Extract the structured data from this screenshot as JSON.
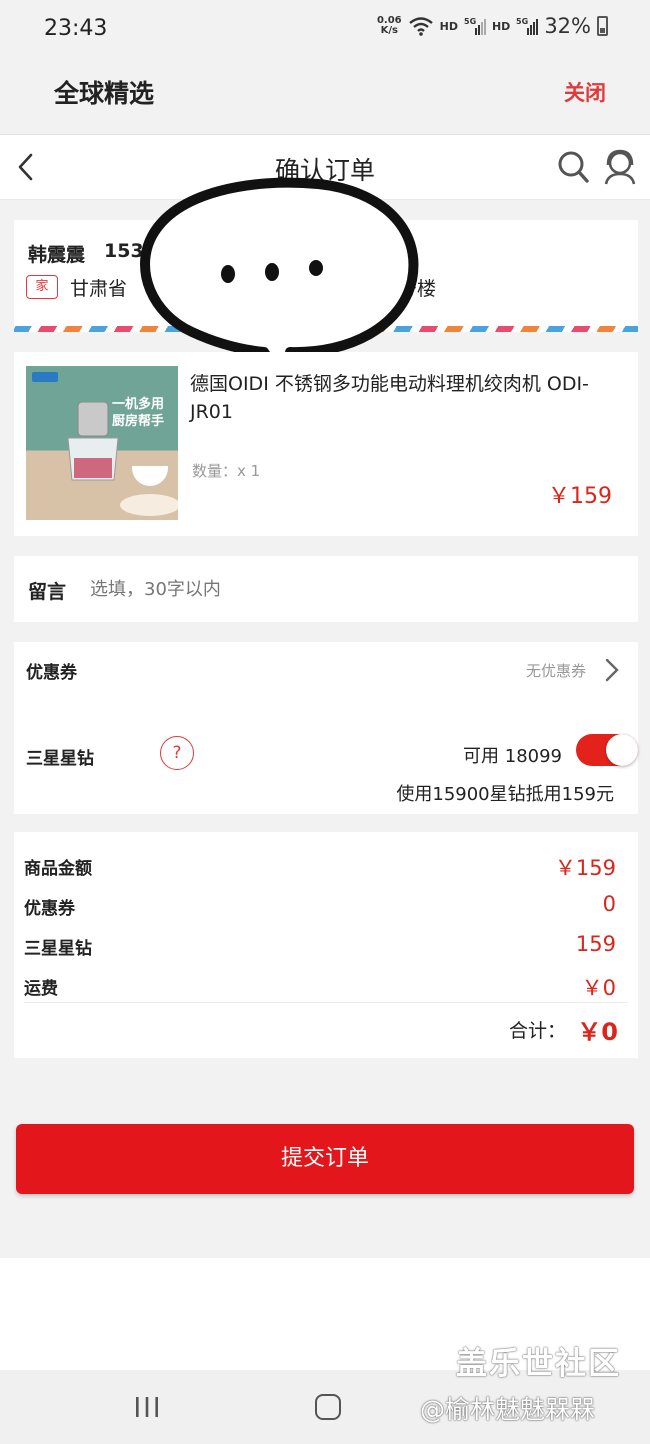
{
  "status_bar": {
    "time": "23:43",
    "net_speed_value": "0.06",
    "net_speed_unit": "K/s",
    "hd1": "HD",
    "hd2": "HD",
    "signal_label": "5G",
    "battery": "32%"
  },
  "app_header": {
    "title": "全球精选",
    "close_label": "关闭"
  },
  "page_header": {
    "title": "确认订单"
  },
  "address": {
    "name": "韩震震",
    "phone_partial": "153",
    "tag": "家",
    "line_start": "甘肃省",
    "line_end": "号楼"
  },
  "product": {
    "name": "德国OIDI 不锈钢多功能电动料理机绞肉机 ODI-JR01",
    "image_tagline_1": "一机多用",
    "image_tagline_2": "厨房帮手",
    "quantity": "数量：x 1",
    "price": "￥159"
  },
  "message": {
    "label": "留言",
    "placeholder": "选填，30字以内",
    "value": ""
  },
  "coupon": {
    "label": "优惠券",
    "value": "无优惠券"
  },
  "diamonds": {
    "label": "三星星钻",
    "help": "?",
    "available": "可用 18099",
    "toggle_on": true,
    "note": "使用15900星钻抵用159元"
  },
  "summary": {
    "rows": [
      {
        "label": "商品金额",
        "value": "￥159"
      },
      {
        "label": "优惠券",
        "value": "0"
      },
      {
        "label": "三星星钻",
        "value": "159"
      },
      {
        "label": "运费",
        "value": "￥0"
      }
    ],
    "total_label": "合计：",
    "total_value": "￥0"
  },
  "submit_label": "提交订单",
  "watermark": {
    "line1": "盖乐世社区",
    "line2": "@榆林魅魅槑槑"
  },
  "colors": {
    "accent": "#e3171b",
    "price": "#d9261c",
    "close": "#e03a3a"
  }
}
